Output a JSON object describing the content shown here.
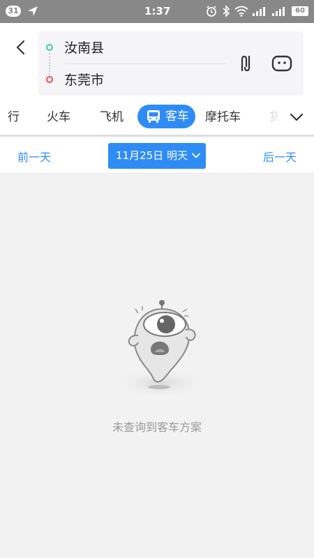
{
  "status_bar": {
    "notification_count": "31",
    "time": "1:37",
    "battery": "60"
  },
  "route": {
    "origin": "汝南县",
    "destination": "东莞市"
  },
  "tabs": {
    "walk": "行",
    "train": "火车",
    "plane": "飞机",
    "bus": "客车",
    "motorcycle": "摩托车",
    "truck": "货"
  },
  "date_bar": {
    "prev_label": "前一天",
    "current_date": "11月25日 明天",
    "next_label": "后一天"
  },
  "empty_state": {
    "message": "未查询到客车方案"
  },
  "colors": {
    "accent": "#2f8cf6",
    "origin_dot": "#3ccf8e",
    "destination_dot": "#ef4b4b",
    "status_bar": "#888888"
  },
  "icons": {
    "back": "chevron-left-icon",
    "swap": "swap-icon",
    "more": "more-icon",
    "bus": "bus-icon",
    "expand": "chevron-down-icon"
  }
}
